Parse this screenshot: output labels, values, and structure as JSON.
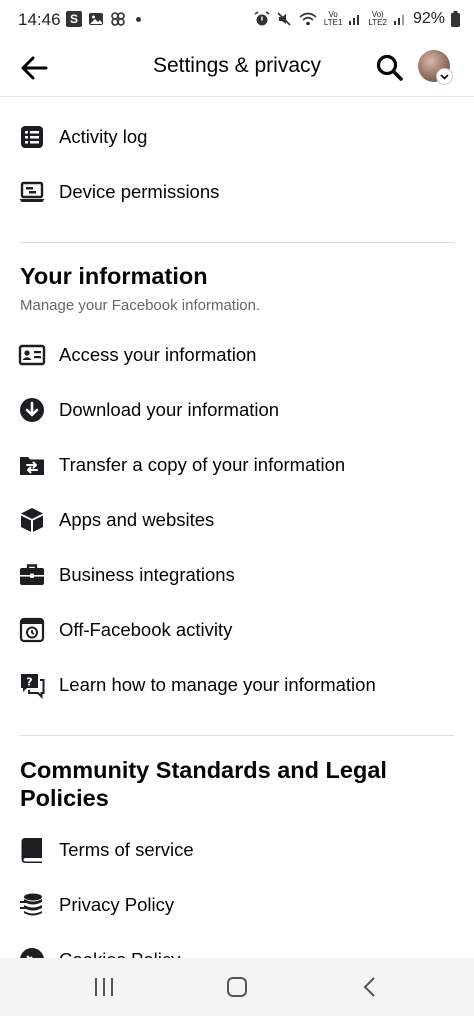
{
  "status": {
    "time": "14:46",
    "battery": "92%",
    "sig1_top": "Vo",
    "sig1_bottom": "LTE1",
    "sig2_top": "Vo)",
    "sig2_bottom": "LTE2"
  },
  "header": {
    "title": "Settings & privacy"
  },
  "top_items": [
    {
      "label": "Activity log",
      "icon": "list-icon"
    },
    {
      "label": "Device permissions",
      "icon": "device-icon"
    }
  ],
  "your_information": {
    "title": "Your information",
    "subtitle": "Manage your Facebook information.",
    "items": [
      {
        "label": "Access your information",
        "icon": "id-card-icon"
      },
      {
        "label": "Download your information",
        "icon": "download-icon"
      },
      {
        "label": "Transfer a copy of your information",
        "icon": "folder-transfer-icon"
      },
      {
        "label": "Apps and websites",
        "icon": "cube-icon"
      },
      {
        "label": "Business integrations",
        "icon": "briefcase-icon"
      },
      {
        "label": "Off-Facebook activity",
        "icon": "history-icon"
      },
      {
        "label": "Learn how to manage your information",
        "icon": "question-chat-icon"
      }
    ]
  },
  "community": {
    "title": "Community Standards and Legal Policies",
    "items": [
      {
        "label": "Terms of service",
        "icon": "book-icon"
      },
      {
        "label": "Privacy Policy",
        "icon": "database-icon"
      },
      {
        "label": "Cookies Policy",
        "icon": "cookie-icon"
      }
    ]
  },
  "colors": {
    "text": "#050505",
    "secondary": "#65676b",
    "divider": "#dadde1",
    "icon": "#1c1e21"
  }
}
